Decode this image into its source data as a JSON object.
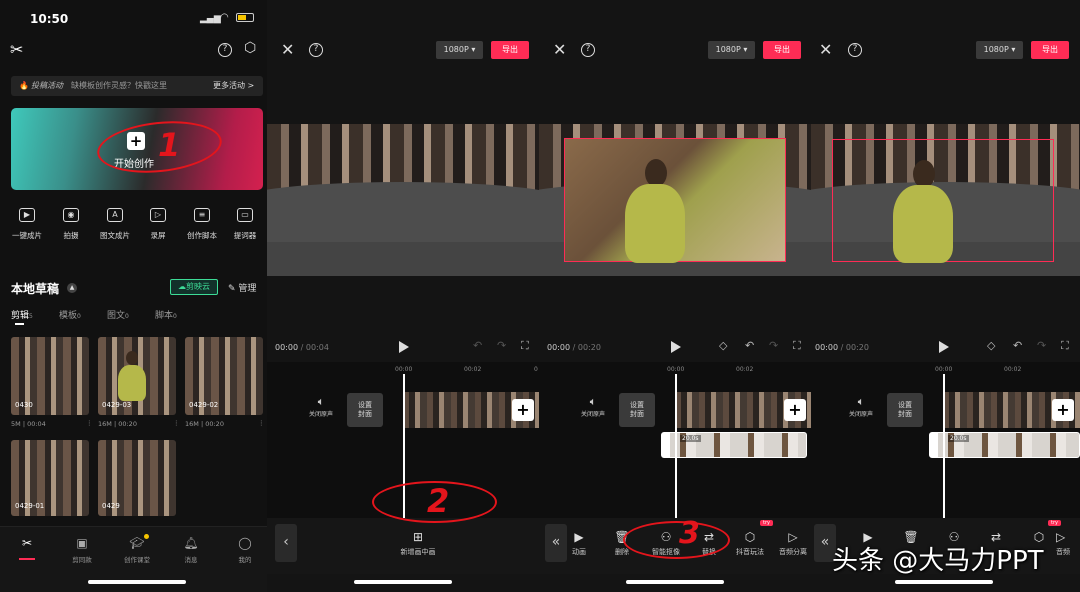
{
  "status_bar": {
    "time": "10:50"
  },
  "home": {
    "promo": {
      "tag": "投稿活动",
      "text": "缺模板创作灵感？快戳这里",
      "more": "更多活动 >"
    },
    "start_create": "开始创作",
    "shortcuts": [
      "一键成片",
      "拍摄",
      "图文成片",
      "录屏",
      "创作脚本",
      "提词器"
    ],
    "drafts_title": "本地草稿",
    "cloud_btn": "剪映云",
    "manage_btn": "管理",
    "tabs": [
      {
        "label": "剪辑",
        "count": "5"
      },
      {
        "label": "模板",
        "count": "0"
      },
      {
        "label": "图文",
        "count": "0"
      },
      {
        "label": "脚本",
        "count": "0"
      }
    ],
    "drafts": [
      {
        "name": "0430",
        "size": "5M",
        "duration": "00:04"
      },
      {
        "name": "0429-03",
        "size": "16M",
        "duration": "00:20"
      },
      {
        "name": "0429-02",
        "size": "16M",
        "duration": "00:20"
      },
      {
        "name": "0429-01",
        "size": "",
        "duration": ""
      },
      {
        "name": "0429",
        "size": "",
        "duration": ""
      }
    ],
    "bottom_nav": [
      "剪同款",
      "创作课堂",
      "消息",
      "我的"
    ]
  },
  "editor": {
    "resolution": "1080P ▾",
    "export": "导出",
    "mute_label": "关闭原声",
    "cover_label": [
      "设置",
      "封面"
    ],
    "clip_duration": "20.0s"
  },
  "panel2": {
    "time_current": "00:00",
    "time_total": "/ 00:04",
    "ruler": [
      "00:00",
      "00:02",
      "0"
    ],
    "tool": "新增画中画"
  },
  "panel3": {
    "time_current": "00:00",
    "time_total": "/ 00:20",
    "ruler": [
      "00:00",
      "00:02"
    ],
    "tools": [
      "动画",
      "删除",
      "智能抠像",
      "替换",
      "抖音玩法",
      "音频分离"
    ],
    "try_badge": "try"
  },
  "panel4": {
    "time_current": "00:00",
    "time_total": "/ 00:20",
    "ruler": [
      "00:00",
      "00:02"
    ],
    "tools": [
      "",
      "",
      "",
      "",
      "",
      "音频"
    ],
    "try_badge": "try"
  },
  "annotations": [
    "1",
    "2",
    "3"
  ],
  "watermark": "头条 @大马力PPT",
  "colors": {
    "accent": "#fe2c55",
    "annotation": "#e4151c",
    "cloud": "#3ddc97"
  }
}
